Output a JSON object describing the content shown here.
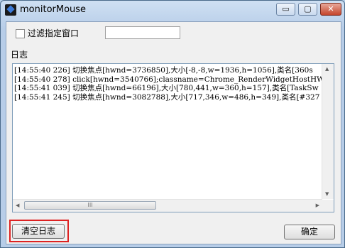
{
  "window": {
    "title": "monitorMouse",
    "controls": {
      "minimize": "▭",
      "maximize": "▢",
      "close": "✕"
    }
  },
  "filter": {
    "checkbox_label": "过滤指定窗口",
    "checked": false,
    "input_value": ""
  },
  "log": {
    "label": "日志",
    "lines": [
      "[14:55:40 226] 切换焦点[hwnd=3736850],大小[-8,-8,w=1936,h=1056],类名[360s",
      "[14:55:40 278] click[hwnd=3540766];classname=Chrome_RenderWidgetHostHWND,",
      "[14:55:41 039] 切换焦点[hwnd=66196],大小[780,441,w=360,h=157],类名[TaskSw",
      "[14:55:41 245] 切换焦点[hwnd=3082788],大小[717,346,w=486,h=349],类名[#327"
    ],
    "scrollbar_thumb_glyph": "III"
  },
  "buttons": {
    "clear_log": "清空日志",
    "ok": "确定"
  },
  "colors": {
    "highlight": "#dd2222"
  }
}
